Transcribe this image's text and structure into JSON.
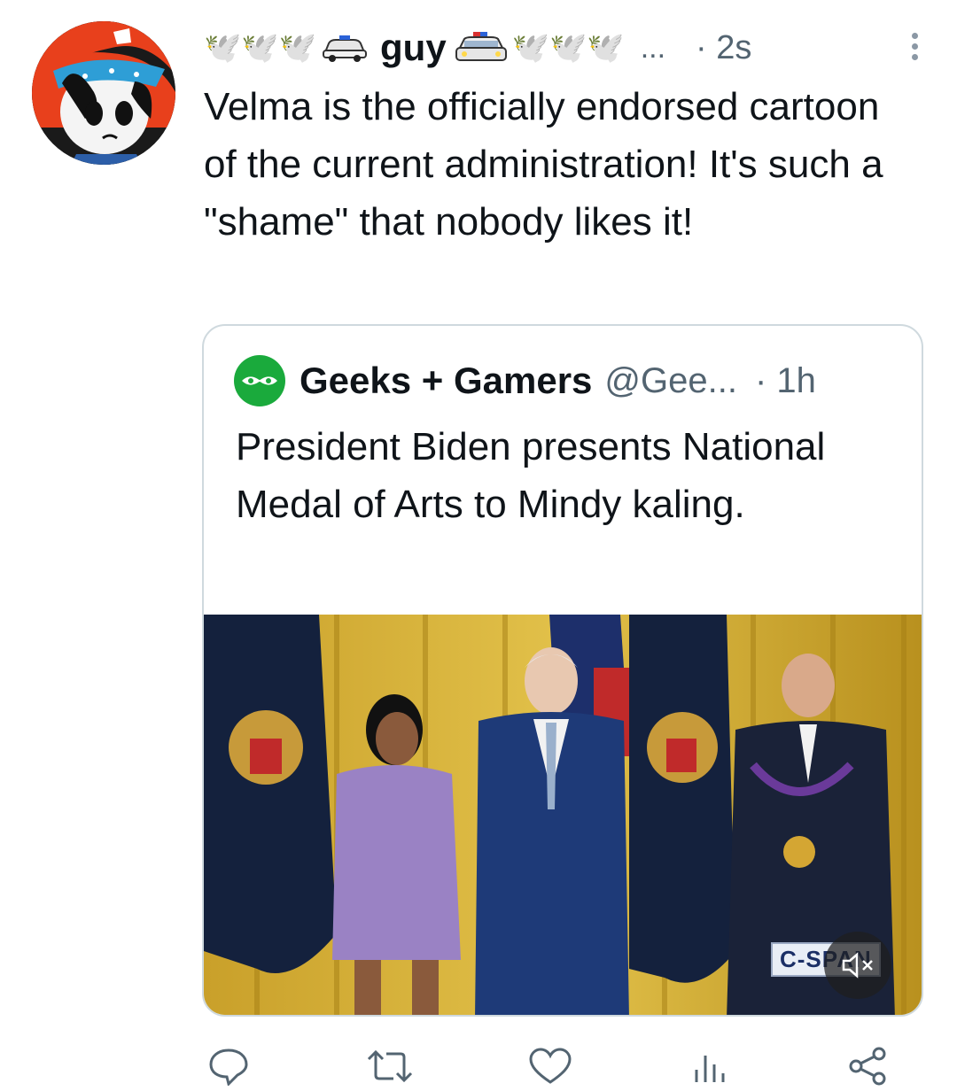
{
  "tweet": {
    "display_name": "guy",
    "name_emoji_left": "🕊️🕊️🕊️",
    "name_emoji_right": "🕊️🕊️🕊️",
    "name_overflow": "...",
    "time": "· 2s",
    "text": "Velma is the officially endorsed cartoon of the current administration! It's such a \"shame\" that nobody likes it!"
  },
  "quote": {
    "name": "Geeks + Gamers",
    "handle": "@Gee...",
    "time": "· 1h",
    "text": "President Biden presents National Medal of Arts to Mindy kaling.",
    "media_watermark": "C-SPAN"
  },
  "icons": {
    "more": "more-vertical-icon",
    "mute": "speaker-muted-icon",
    "reply": "reply-icon",
    "retweet": "retweet-icon",
    "like": "heart-icon",
    "views": "views-icon",
    "share": "share-icon"
  },
  "colors": {
    "accent_green": "#1aaa3c",
    "secondary_text": "#536471",
    "border": "#cfd9de"
  }
}
